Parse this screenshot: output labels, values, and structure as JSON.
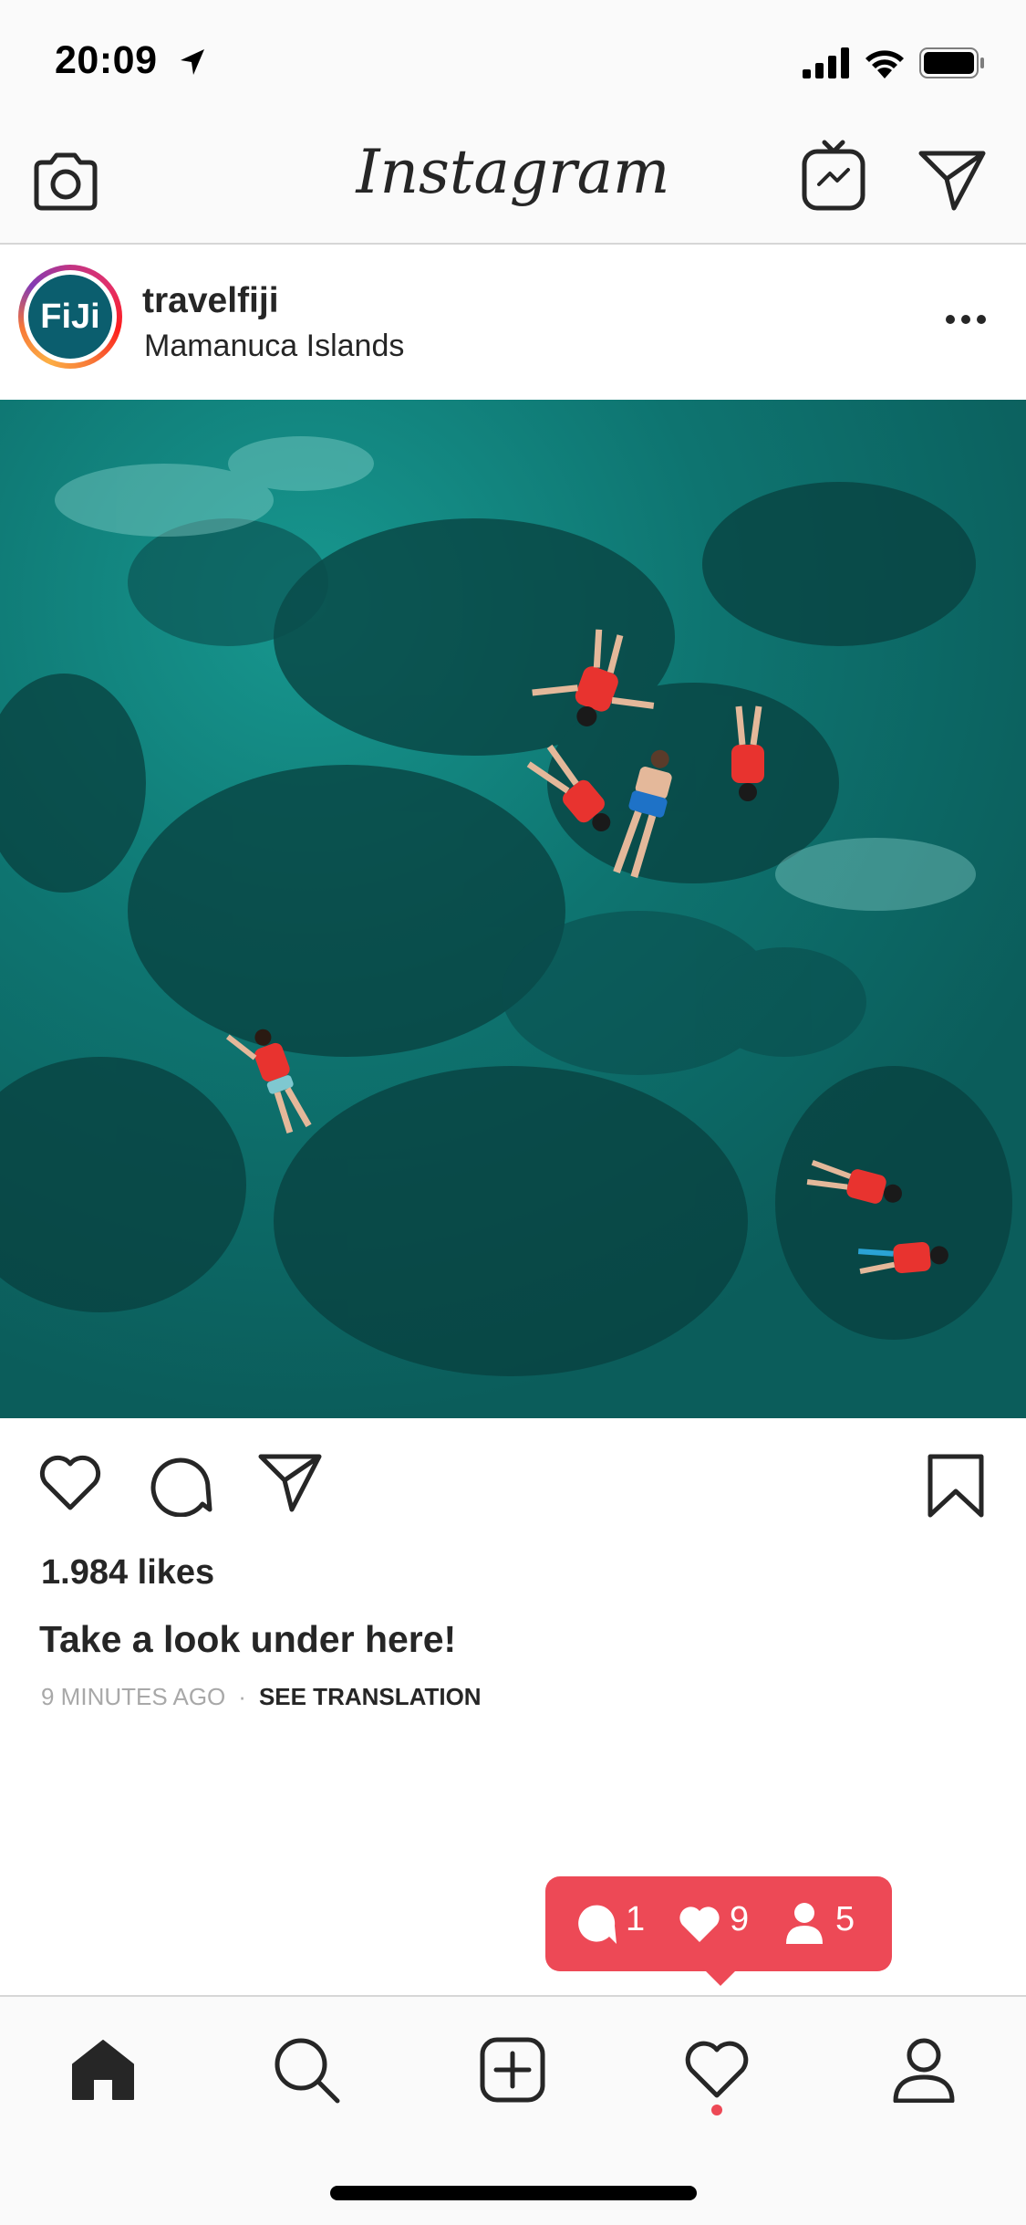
{
  "status_bar": {
    "time": "20:09",
    "icons": [
      "location-arrow-icon",
      "signal-icon",
      "wifi-icon",
      "battery-icon"
    ]
  },
  "top_nav": {
    "logo": "Instagram",
    "icons": [
      "camera-icon",
      "igtv-icon",
      "direct-send-icon"
    ]
  },
  "post": {
    "avatar_text": "FiJi",
    "username": "travelfiji",
    "location": "Mamanuca Islands",
    "likes": "1.984 likes",
    "caption": "Take a look under here!",
    "time_ago": "9 MINUTES AGO",
    "separator": "·",
    "see_translation": "SEE TRANSLATION"
  },
  "activity_bubble": {
    "comments": "1",
    "likes": "9",
    "follows": "5",
    "color": "#ed4956"
  },
  "bottom_nav": {
    "items": [
      "home-icon",
      "search-icon",
      "add-post-icon",
      "activity-heart-icon",
      "profile-icon"
    ]
  },
  "colors": {
    "accent": "#ed4956",
    "text": "#262626",
    "muted": "#a8a8a8",
    "water": "#0f6f6c"
  }
}
